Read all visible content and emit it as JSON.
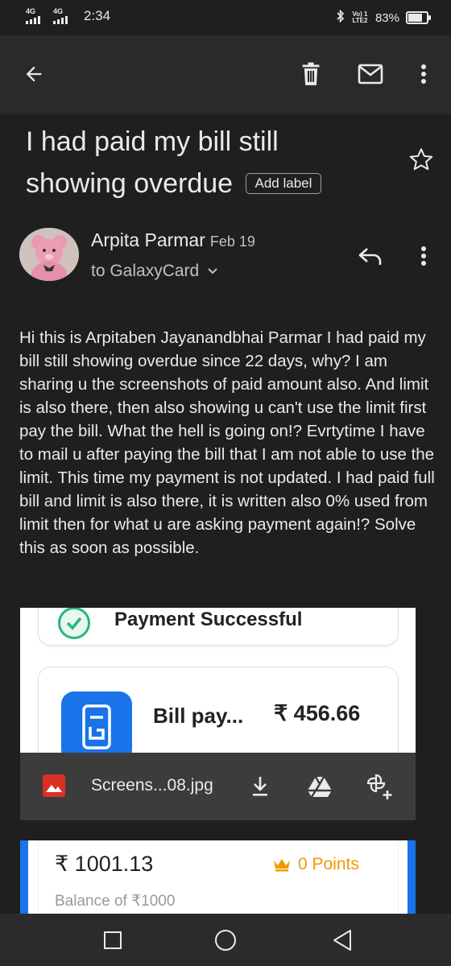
{
  "status_bar": {
    "network_1": "4G",
    "network_2": "4G",
    "time": "2:34",
    "volte": "Vo) 1 LTE2",
    "battery": "83%",
    "battery_level": 0.83,
    "icons": [
      "signal-icon",
      "bluetooth-icon",
      "battery-icon"
    ]
  },
  "toolbar": {
    "icons": [
      "back-arrow-icon",
      "delete-icon",
      "mark-unread-icon",
      "more-vert-icon"
    ]
  },
  "email": {
    "subject": "I had paid my bill still showing overdue",
    "add_label": "Add label",
    "sender_name": "Arpita Parmar",
    "date": "Feb 19",
    "to": "to GalaxyCard",
    "body": "Hi this is Arpitaben Jayanandbhai Parmar I had paid my bill still showing overdue since 22 days, why? I am sharing u the screenshots of paid amount also. And limit is also there, then also showing u can't use the limit first pay the bill. What the hell is going on!? Evrtytime I have to mail u after paying the bill that I am not able to use the limit. This time my payment is not updated. I had paid full bill and limit is also there, it is written also 0% used from limit then for what u are asking payment again!? Solve this as soon as possible."
  },
  "attachment": {
    "preview_heading": "Payment Successful",
    "preview_item": "Bill pay...",
    "preview_amount": "₹ 456.66",
    "filename": "Screens...08.jpg",
    "actions": [
      "download-icon",
      "drive-icon",
      "add-to-photos-icon"
    ]
  },
  "attachment2": {
    "amount": "₹ 1001.13",
    "points": "0 Points",
    "balance": "Balance of ₹1000"
  },
  "nav": {
    "buttons": [
      "recents-button",
      "home-button",
      "back-button"
    ]
  }
}
